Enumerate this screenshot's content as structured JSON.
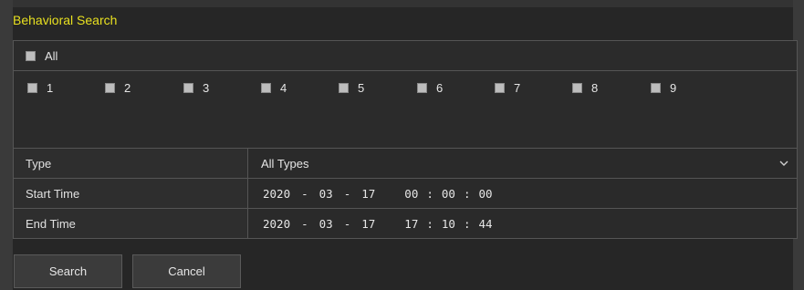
{
  "header": {
    "title": "Behavioral Search"
  },
  "channels": {
    "all_label": "All",
    "items": [
      "1",
      "2",
      "3",
      "4",
      "5",
      "6",
      "7",
      "8",
      "9"
    ]
  },
  "filters": {
    "type": {
      "label": "Type",
      "value": "All Types"
    },
    "start": {
      "label": "Start Time",
      "year": "2020",
      "month": "03",
      "day": "17",
      "hour": "00",
      "minute": "00",
      "second": "00"
    },
    "end": {
      "label": "End Time",
      "year": "2020",
      "month": "03",
      "day": "17",
      "hour": "17",
      "minute": "10",
      "second": "44"
    },
    "date_sep": "-",
    "time_sep": ":"
  },
  "buttons": {
    "search": "Search",
    "cancel": "Cancel"
  },
  "colors": {
    "title": "#e8e020",
    "background": "#262626"
  }
}
